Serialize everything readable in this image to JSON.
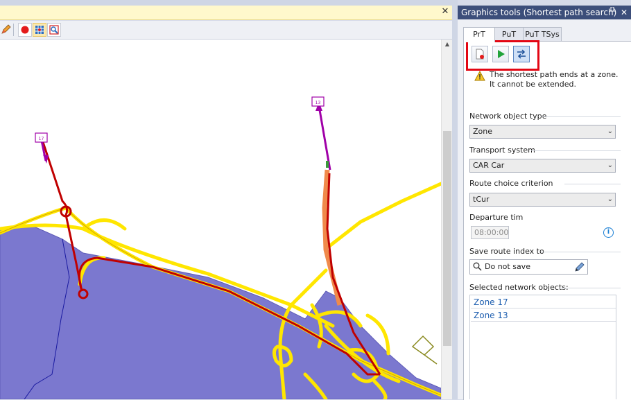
{
  "doc": {
    "close_glyph": "✕"
  },
  "map_toolbar": {
    "icons": [
      "pencil-icon",
      "record-icon",
      "grid-zoom-icon",
      "zoom-window-icon"
    ]
  },
  "map": {
    "zone_markers": [
      "17",
      "13"
    ],
    "colors": {
      "zone_fill": "#7b78cf",
      "links": "#ffe600",
      "route": "#c00000",
      "connector": "#a000a8",
      "highlight": "#f08a4b"
    }
  },
  "panel": {
    "title": "Graphics tools (Shortest path search)",
    "pin_glyph": "🖈",
    "close_glyph": "✕",
    "tabs": [
      {
        "label": "PrT",
        "active": true
      },
      {
        "label": "PuT",
        "active": false
      },
      {
        "label": "PuT TSys",
        "active": false
      }
    ],
    "tools": [
      "new-search-icon",
      "execute-play-icon",
      "swap-direction-icon"
    ],
    "warning_text": "The shortest path ends at a zone. It cannot be extended.",
    "network_object_type": {
      "label": "Network object type",
      "value": "Zone"
    },
    "transport_system": {
      "label": "Transport system",
      "value": "CAR Car"
    },
    "route_choice": {
      "label": "Route choice criterion",
      "value": "tCur"
    },
    "departure": {
      "label": "Departure tim",
      "value": "08:00:00"
    },
    "save_route": {
      "label": "Save route index to",
      "value": "Do not save"
    },
    "selected": {
      "label": "Selected network objects:",
      "items": [
        "Zone 17",
        "Zone 13"
      ]
    },
    "colors": {
      "header_bg": "#3c4e7a",
      "highlight_frame": "#e30613",
      "link_text": "#1e5fb0"
    }
  }
}
